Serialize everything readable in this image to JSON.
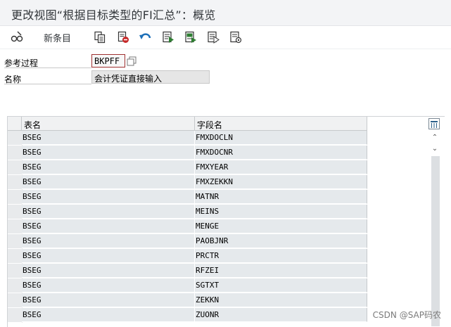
{
  "window": {
    "title": "更改视图“根据目标类型的FI汇总”：概览"
  },
  "toolbar": {
    "new_entries": "新条目"
  },
  "fields": {
    "ref_label": "参考过程",
    "ref_value": "BKPFF",
    "name_label": "名称",
    "name_value": "会计凭证直接输入"
  },
  "table": {
    "columns": [
      "表名",
      "字段名"
    ],
    "rows": [
      [
        "BSEG",
        "FMXDOCLN"
      ],
      [
        "BSEG",
        "FMXDOCNR"
      ],
      [
        "BSEG",
        "FMXYEAR"
      ],
      [
        "BSEG",
        "FMXZEKKN"
      ],
      [
        "BSEG",
        "MATNR"
      ],
      [
        "BSEG",
        "MEINS"
      ],
      [
        "BSEG",
        "MENGE"
      ],
      [
        "BSEG",
        "PAOBJNR"
      ],
      [
        "BSEG",
        "PRCTR"
      ],
      [
        "BSEG",
        "RFZEI"
      ],
      [
        "BSEG",
        "SGTXT"
      ],
      [
        "BSEG",
        "ZEKKN"
      ],
      [
        "BSEG",
        "ZUONR"
      ]
    ]
  },
  "watermark": "CSDN @SAP码农",
  "colors": {
    "accent_red": "#a03030",
    "icon_green": "#2e7d32",
    "icon_blue": "#1d6fb8"
  }
}
